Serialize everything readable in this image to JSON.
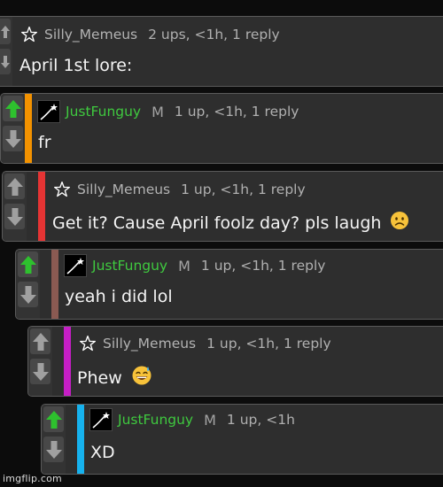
{
  "comments": [
    {
      "user": "Silly_Memeus",
      "mod": "",
      "meta": "2 ups, <1h, 1 reply",
      "text": "April 1st lore:",
      "emoji": "",
      "bar_color": "",
      "user_color": "#b3b3b3",
      "avatar": "star-icon"
    },
    {
      "user": "JustFunguy",
      "mod": "M",
      "meta": "1 up, <1h, 1 reply",
      "text": "fr",
      "emoji": "",
      "bar_color": "#f39200",
      "user_color": "#3fc93f",
      "avatar": "shooting-star-icon"
    },
    {
      "user": "Silly_Memeus",
      "mod": "",
      "meta": "1 up, <1h, 1 reply",
      "text": "Get it? Cause April foolz day? pls laugh",
      "emoji": "frowning-face",
      "bar_color": "#e53434",
      "user_color": "#b3b3b3",
      "avatar": "star-icon"
    },
    {
      "user": "JustFunguy",
      "mod": "M",
      "meta": "1 up, <1h, 1 reply",
      "text": "yeah i did lol",
      "emoji": "",
      "bar_color": "#8a5a52",
      "user_color": "#3fc93f",
      "avatar": "shooting-star-icon"
    },
    {
      "user": "Silly_Memeus",
      "mod": "",
      "meta": "1 up, <1h, 1 reply",
      "text": "Phew",
      "emoji": "grinning-sweat",
      "bar_color": "#c51ec5",
      "user_color": "#b3b3b3",
      "avatar": "star-icon"
    },
    {
      "user": "JustFunguy",
      "mod": "M",
      "meta": "1 up, <1h",
      "text": "XD",
      "emoji": "",
      "bar_color": "#16b2ee",
      "user_color": "#3fc93f",
      "avatar": "shooting-star-icon"
    }
  ],
  "votes": {
    "upvoted_color": "#2ec12e",
    "neutral_color": "#a0a0a0"
  },
  "watermark": "imgflip.com"
}
